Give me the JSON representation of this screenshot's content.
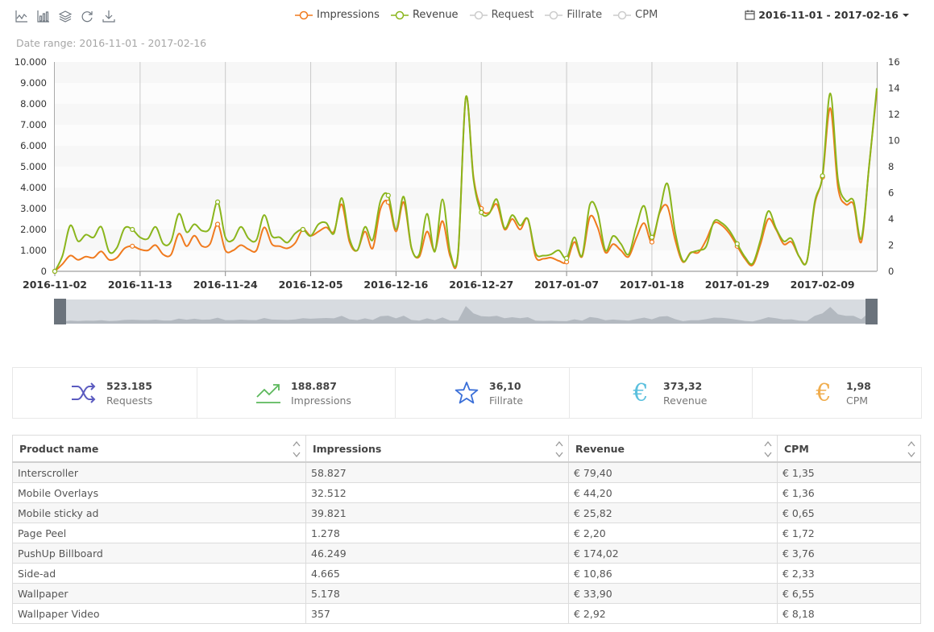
{
  "toolbar": {
    "icons": [
      "line-chart-icon",
      "bar-chart-icon",
      "stack-icon",
      "refresh-icon",
      "download-icon"
    ]
  },
  "legend": [
    {
      "label": "Impressions",
      "color": "#f07a1e",
      "active": true
    },
    {
      "label": "Revenue",
      "color": "#8ab51c",
      "active": true
    },
    {
      "label": "Request",
      "color": "#cccccc",
      "active": false
    },
    {
      "label": "Fillrate",
      "color": "#cccccc",
      "active": false
    },
    {
      "label": "CPM",
      "color": "#cccccc",
      "active": false
    }
  ],
  "date_picker": {
    "value": "2016-11-01 - 2017-02-16"
  },
  "date_range_label": "Date range: 2016-11-01 - 2017-02-16",
  "chart_data": {
    "type": "line",
    "x_start": "2016-11-02",
    "x_ticks": [
      "2016-11-02",
      "2016-11-13",
      "2016-11-24",
      "2016-12-05",
      "2016-12-16",
      "2016-12-27",
      "2017-01-07",
      "2017-01-18",
      "2017-01-29",
      "2017-02-09"
    ],
    "y_left_ticks": [
      "0",
      "1.000",
      "2.000",
      "3.000",
      "4.000",
      "5.000",
      "6.000",
      "7.000",
      "8.000",
      "9.000",
      "10.000"
    ],
    "y_right_ticks": [
      "0",
      "2",
      "4",
      "6",
      "8",
      "10",
      "12",
      "14",
      "16"
    ],
    "ylim_left": [
      0,
      10000
    ],
    "ylim_right": [
      0,
      16
    ],
    "series": [
      {
        "name": "Impressions",
        "axis": "left",
        "color": "#f07a1e",
        "values": [
          0,
          350,
          750,
          550,
          700,
          650,
          950,
          550,
          650,
          1100,
          1200,
          1050,
          1000,
          1250,
          800,
          800,
          1800,
          1200,
          1700,
          1200,
          1300,
          2250,
          1000,
          1000,
          1250,
          1050,
          1000,
          2100,
          1300,
          1200,
          1100,
          1350,
          2000,
          1700,
          1900,
          2100,
          1900,
          3200,
          1400,
          1000,
          1900,
          1100,
          3000,
          3300,
          1900,
          3300,
          1100,
          700,
          1900,
          1000,
          2400,
          700,
          800,
          8300,
          4500,
          3000,
          2800,
          3200,
          2000,
          2500,
          2000,
          2500,
          700,
          600,
          650,
          500,
          450,
          1400,
          700,
          2600,
          2100,
          900,
          1300,
          1000,
          700,
          1600,
          2300,
          1400,
          2800,
          3100,
          1500,
          450,
          900,
          900,
          1500,
          2300,
          2200,
          1800,
          1200,
          600,
          300,
          1300,
          2500,
          2000,
          1300,
          1400,
          700,
          500,
          3200,
          4500,
          7800,
          4000,
          3200,
          3200,
          1400,
          5000,
          8600
        ]
      },
      {
        "name": "Revenue",
        "axis": "right",
        "color": "#8ab51c",
        "values": [
          0,
          1.2,
          3.5,
          2.3,
          2.8,
          2.6,
          3.4,
          1.5,
          1.8,
          3.3,
          3.2,
          2.6,
          2.5,
          3.4,
          2.1,
          2.3,
          4.4,
          3.0,
          3.6,
          3.1,
          3.3,
          5.3,
          2.6,
          2.4,
          3.4,
          2.5,
          2.4,
          4.3,
          2.7,
          2.6,
          2.2,
          2.9,
          3.2,
          2.7,
          3.6,
          3.7,
          2.9,
          5.6,
          2.5,
          1.6,
          3.4,
          2.4,
          5.4,
          5.8,
          3.2,
          5.7,
          1.8,
          1.3,
          4.4,
          1.5,
          5.5,
          1.4,
          1.4,
          13.3,
          7.0,
          4.5,
          4.4,
          5.5,
          3.3,
          4.3,
          3.5,
          4.0,
          1.4,
          1.2,
          1.3,
          1.6,
          1.0,
          2.6,
          1.2,
          5.1,
          4.5,
          1.6,
          2.7,
          2.1,
          1.3,
          3.4,
          5.0,
          2.6,
          4.6,
          6.7,
          3.0,
          0.8,
          1.4,
          1.6,
          1.9,
          3.8,
          3.7,
          3.1,
          2.1,
          1.1,
          0.6,
          2.4,
          4.6,
          3.3,
          2.3,
          2.5,
          1.1,
          0.8,
          5.3,
          7.3,
          13.6,
          7.0,
          5.4,
          5.4,
          2.5,
          8.0,
          14.0
        ]
      }
    ],
    "grid": true,
    "legend_position": "top-center"
  },
  "stats": [
    {
      "icon": "shuffle-icon",
      "value": "523.185",
      "label": "Requests",
      "color": "#5b5bc0"
    },
    {
      "icon": "trend-up-icon",
      "value": "188.887",
      "label": "Impressions",
      "color": "#5cb85c"
    },
    {
      "icon": "star-icon",
      "value": "36,10",
      "label": "Fillrate",
      "color": "#3a6fd8"
    },
    {
      "icon": "euro-icon",
      "value": "373,32",
      "label": "Revenue",
      "color": "#5bc0de"
    },
    {
      "icon": "euro-icon",
      "value": "1,98",
      "label": "CPM",
      "color": "#f0ad4e"
    }
  ],
  "table": {
    "columns": [
      "Product name",
      "Impressions",
      "Revenue",
      "CPM"
    ],
    "rows": [
      [
        "Interscroller",
        "58.827",
        "€ 79,40",
        "€ 1,35"
      ],
      [
        "Mobile Overlays",
        "32.512",
        "€ 44,20",
        "€ 1,36"
      ],
      [
        "Mobile sticky ad",
        "39.821",
        "€ 25,82",
        "€ 0,65"
      ],
      [
        "Page Peel",
        "1.278",
        "€ 2,20",
        "€ 1,72"
      ],
      [
        "PushUp Billboard",
        "46.249",
        "€ 174,02",
        "€ 3,76"
      ],
      [
        "Side-ad",
        "4.665",
        "€ 10,86",
        "€ 2,33"
      ],
      [
        "Wallpaper",
        "5.178",
        "€ 33,90",
        "€ 6,55"
      ],
      [
        "Wallpaper Video",
        "357",
        "€ 2,92",
        "€ 8,18"
      ]
    ]
  }
}
